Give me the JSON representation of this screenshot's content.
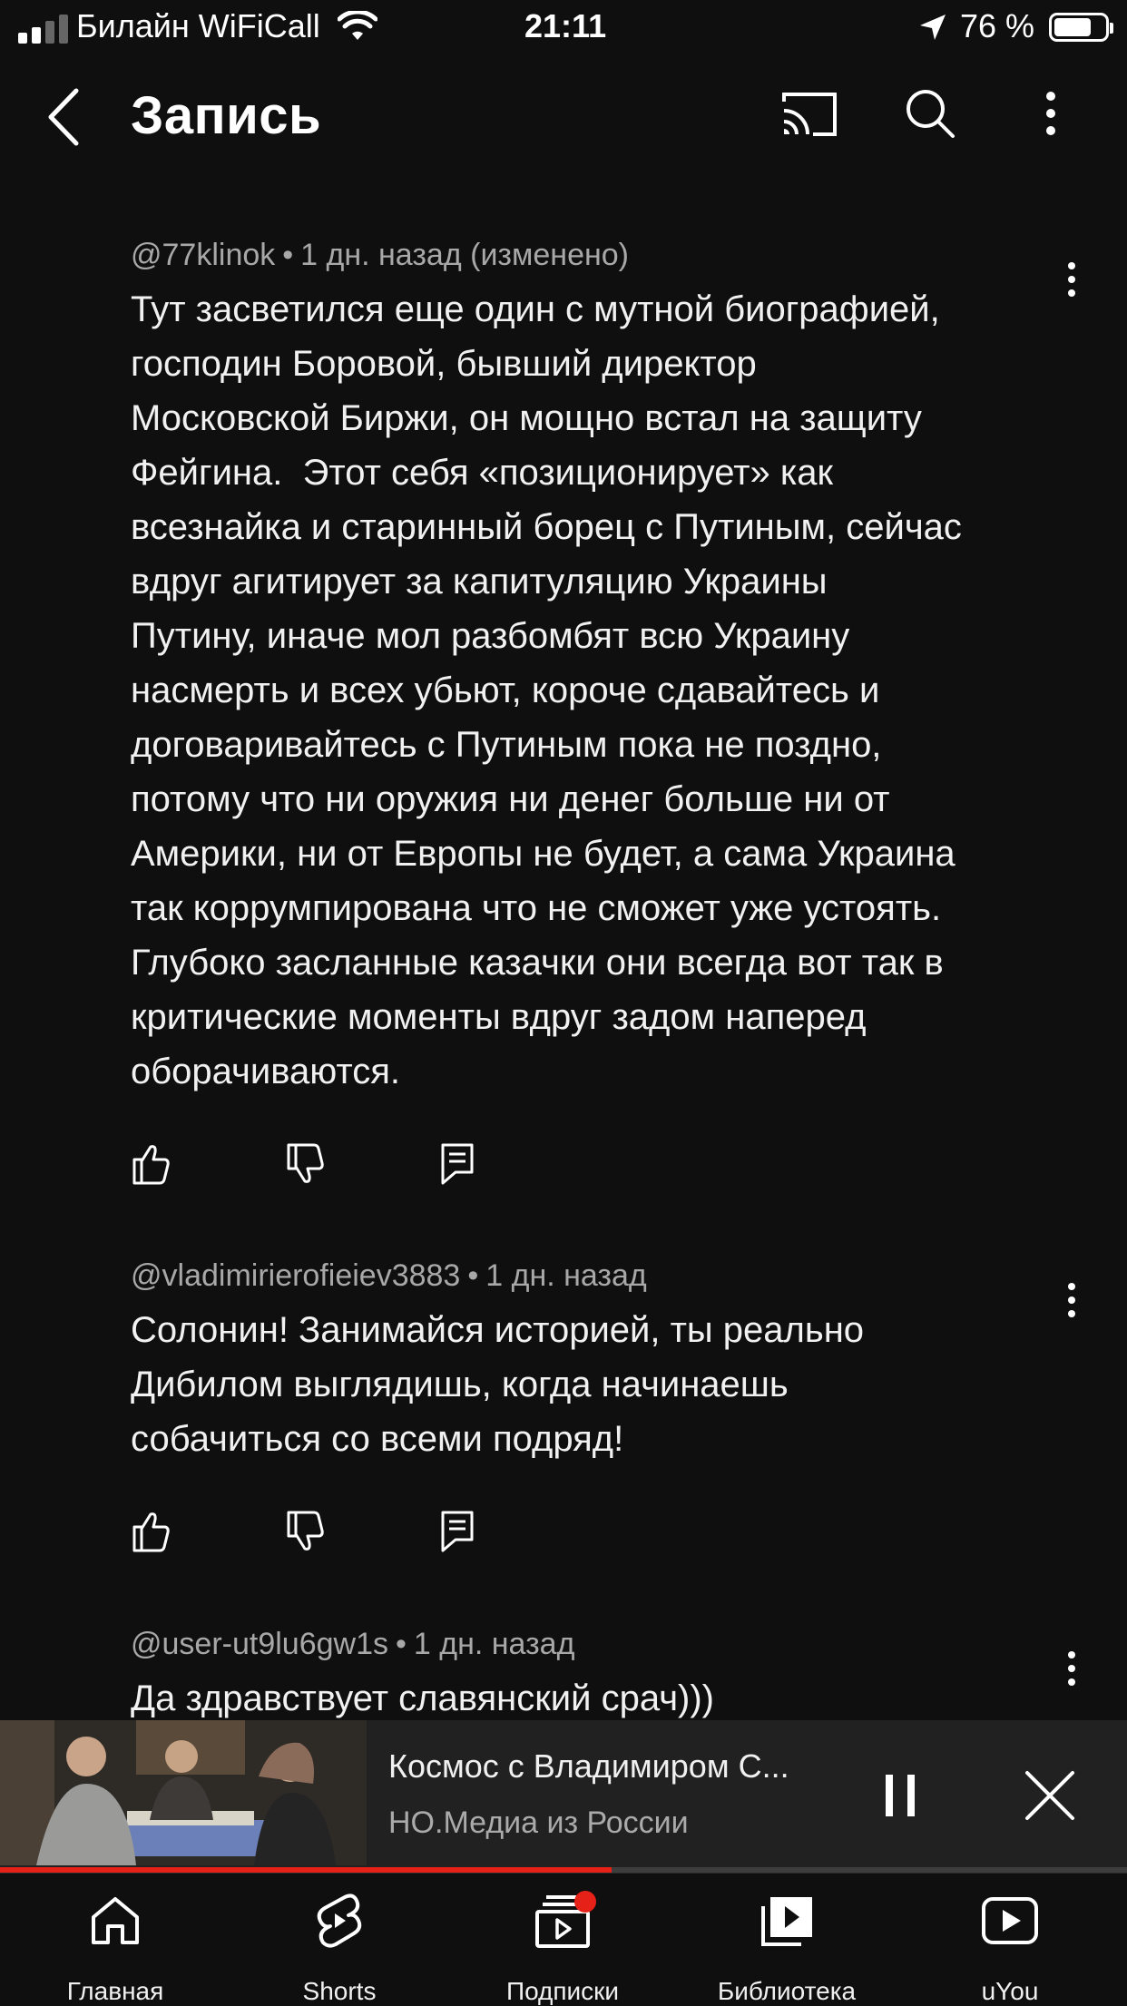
{
  "status": {
    "carrier": "Билайн WiFiCall",
    "time": "21:11",
    "battery": "76 %",
    "battery_level": 0.76
  },
  "header": {
    "title": "Запись",
    "icons": [
      "back-icon",
      "cast-icon",
      "search-icon",
      "more-vert-icon"
    ]
  },
  "comments": [
    {
      "author": "@77klinok",
      "time": "1 дн. назад (изменено)",
      "text": "Тут засветился еще один с мутной биографией,\nгосподин Боровой, бывший директор\nМосковской Биржи, он мощно встал на защиту\nФейгина.  Этот себя «позиционирует» как\nвсезнайка и старинный борец с Путиным, сейчас\nвдруг агитирует за капитуляцию Украины\nПутину, иначе мол разбомбят всю Украину\nнасмерть и всех убьют, короче сдавайтесь и\nдоговаривайтесь с Путиным пока не поздно,\nпотому что ни оружия ни денег больше ни от\nАмерики, ни от Европы не будет, а сама Украина\nтак коррумпирована что не сможет уже устоять.\nГлубоко засланные казачки они всегда вот так в\nкритические моменты вдруг задом наперед\nоборачиваются."
    },
    {
      "author": "@vladimirierofieiev3883",
      "time": "1 дн. назад",
      "text": "Солонин! Занимайся историей, ты реально\nДибилом выглядишь, когда начинаешь\nсобачиться со всеми подряд!"
    },
    {
      "author": "@user-ut9lu6gw1s",
      "time": "1 дн. назад",
      "text": "Да здравствует славянский срач)))"
    }
  ],
  "mini_player": {
    "title": "Космос с Владимиром С...",
    "channel": "НО.Медиа из России",
    "progress": 0.543
  },
  "nav": [
    {
      "label": "Главная",
      "icon": "home-icon"
    },
    {
      "label": "Shorts",
      "icon": "shorts-icon"
    },
    {
      "label": "Подписки",
      "icon": "subscriptions-icon"
    },
    {
      "label": "Библиотека",
      "icon": "library-icon"
    },
    {
      "label": "uYou",
      "icon": "uyou-icon"
    }
  ],
  "colors": {
    "background": "#0f0f0f",
    "accent": "#e62117",
    "meta_text": "#a8a8a8"
  }
}
